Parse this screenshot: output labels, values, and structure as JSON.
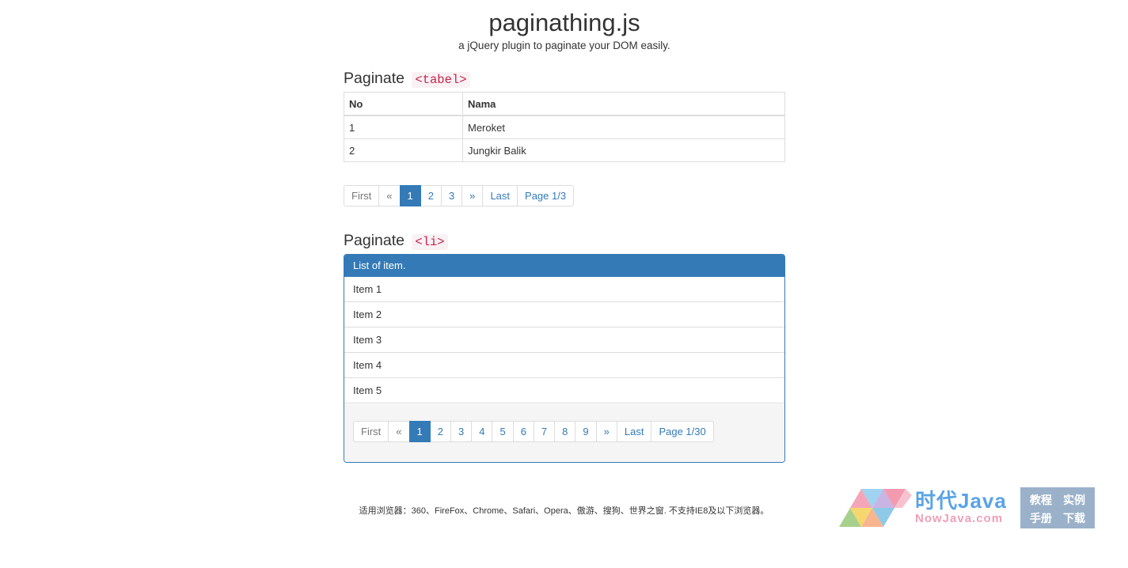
{
  "header": {
    "title": "paginathing.js",
    "subtitle": "a jQuery plugin to paginate your DOM easily."
  },
  "section_table": {
    "heading": "Paginate",
    "tag": "<tabel>",
    "columns": [
      "No",
      "Nama"
    ],
    "rows": [
      [
        "1",
        "Meroket"
      ],
      [
        "2",
        "Jungkir Balik"
      ]
    ],
    "pager": {
      "first": "First",
      "prev": "«",
      "pages": [
        "1",
        "2",
        "3"
      ],
      "active_page": "1",
      "next": "»",
      "last": "Last",
      "info": "Page 1/3"
    }
  },
  "section_list": {
    "heading": "Paginate",
    "tag": "<li>",
    "panel_title": "List of item.",
    "items": [
      "Item 1",
      "Item 2",
      "Item 3",
      "Item 4",
      "Item 5"
    ],
    "pager": {
      "first": "First",
      "prev": "«",
      "pages": [
        "1",
        "2",
        "3",
        "4",
        "5",
        "6",
        "7",
        "8",
        "9"
      ],
      "active_page": "1",
      "next": "»",
      "last": "Last",
      "info": "Page 1/30"
    }
  },
  "footer": {
    "note": "适用浏览器：360、FireFox、Chrome、Safari、Opera、傲游、搜狗、世界之窗. 不支持IE8及以下浏览器。"
  },
  "watermark": {
    "logo_icon": "triangle-mosaic-icon",
    "brand": "时代Java",
    "domain": "NowJava.com",
    "links": [
      "教程",
      "实例",
      "手册",
      "下载"
    ]
  },
  "colors": {
    "primary": "#337ab7",
    "code_text": "#c7254e",
    "code_bg": "#f9f2f4",
    "border": "#dddddd",
    "panel_footer_bg": "#f5f5f5"
  }
}
